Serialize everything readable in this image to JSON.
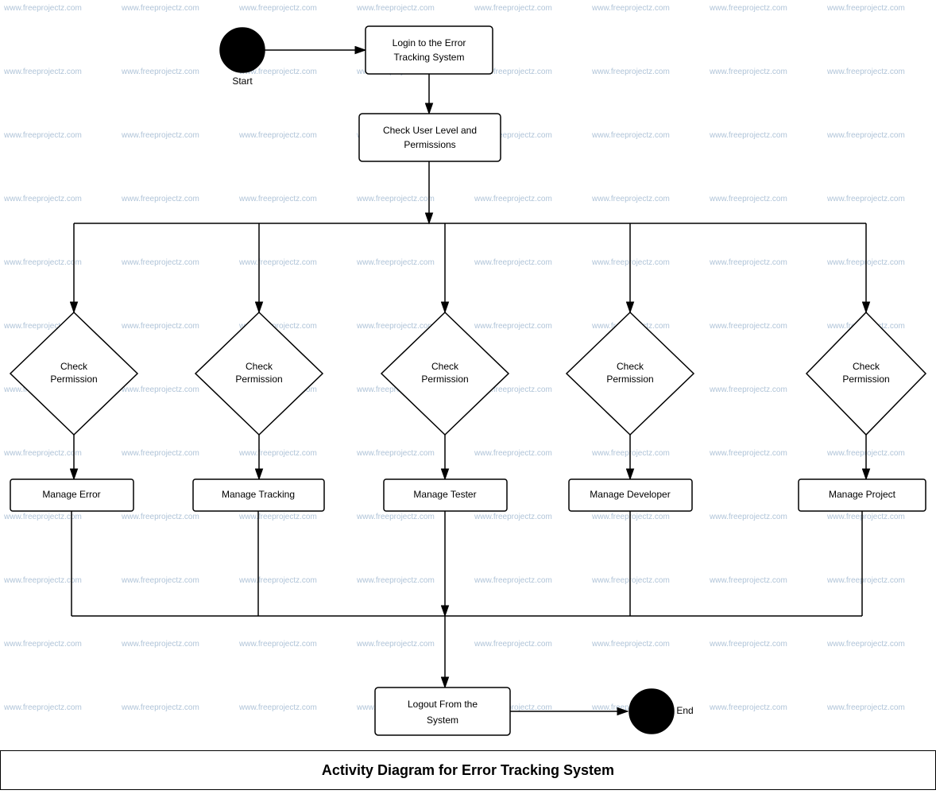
{
  "title": "Activity Diagram for Error Tracking System",
  "nodes": {
    "start_label": "Start",
    "end_label": "End",
    "login": "Login to the Error\nTracking System",
    "check_user": "Check User Level and\nPermissions",
    "check_perm1": "Check\nPermission",
    "check_perm2": "Check\nPermission",
    "check_perm3": "Check\nPermission",
    "check_perm4": "Check\nPermission",
    "check_perm5": "Check\nPermission",
    "manage_error": "Manage Error",
    "manage_tracking": "Manage Tracking",
    "manage_tester": "Manage Tester",
    "manage_developer": "Manage Developer",
    "manage_project": "Manage Project",
    "logout": "Logout From the\nSystem"
  },
  "watermark": "www.freeprojectz.com"
}
